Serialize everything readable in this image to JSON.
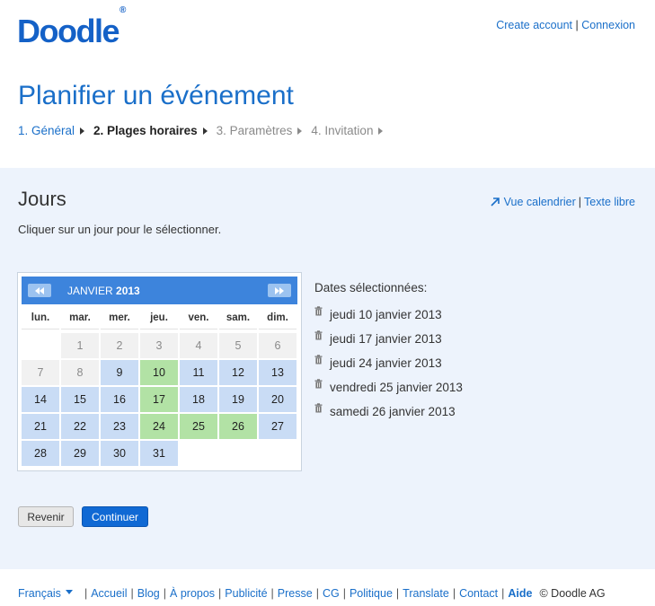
{
  "header": {
    "logo_text": "Doodle",
    "logo_mark": "®",
    "create_account": "Create account",
    "login": "Connexion",
    "sep": "|"
  },
  "page": {
    "title": "Planifier un événement",
    "steps": [
      {
        "label": "1. Général",
        "state": "done"
      },
      {
        "label": "2. Plages horaires",
        "state": "active"
      },
      {
        "label": "3. Paramètres",
        "state": "todo"
      },
      {
        "label": "4. Invitation",
        "state": "todo"
      }
    ]
  },
  "section": {
    "title": "Jours",
    "hint": "Cliquer sur un jour pour le sélectionner.",
    "calendar_view": "Vue calendrier",
    "free_text": "Texte libre",
    "sep": "|"
  },
  "calendar": {
    "month": "JANVIER",
    "year": "2013",
    "weekdays": [
      "lun.",
      "mar.",
      "mer.",
      "jeu.",
      "ven.",
      "sam.",
      "dim."
    ],
    "lead_empty": 1,
    "days_in_month": 31,
    "past_until": 8,
    "selected": [
      10,
      17,
      24,
      25,
      26
    ]
  },
  "selected_dates": {
    "title": "Dates sélectionnées:",
    "items": [
      "jeudi 10 janvier 2013",
      "jeudi 17 janvier 2013",
      "jeudi 24 janvier 2013",
      "vendredi 25 janvier 2013",
      "samedi 26 janvier 2013"
    ]
  },
  "buttons": {
    "back": "Revenir",
    "continue": "Continuer"
  },
  "footer": {
    "language": "Français",
    "links": [
      "Accueil",
      "Blog",
      "À propos",
      "Publicité",
      "Presse",
      "CG",
      "Politique",
      "Translate",
      "Contact"
    ],
    "help": "Aide",
    "copyright": "© Doodle AG"
  },
  "colors": {
    "brand": "#1461c7",
    "link": "#1a6fc9",
    "selected_day": "#b2e2a5",
    "available_day": "#c9dcf5"
  }
}
